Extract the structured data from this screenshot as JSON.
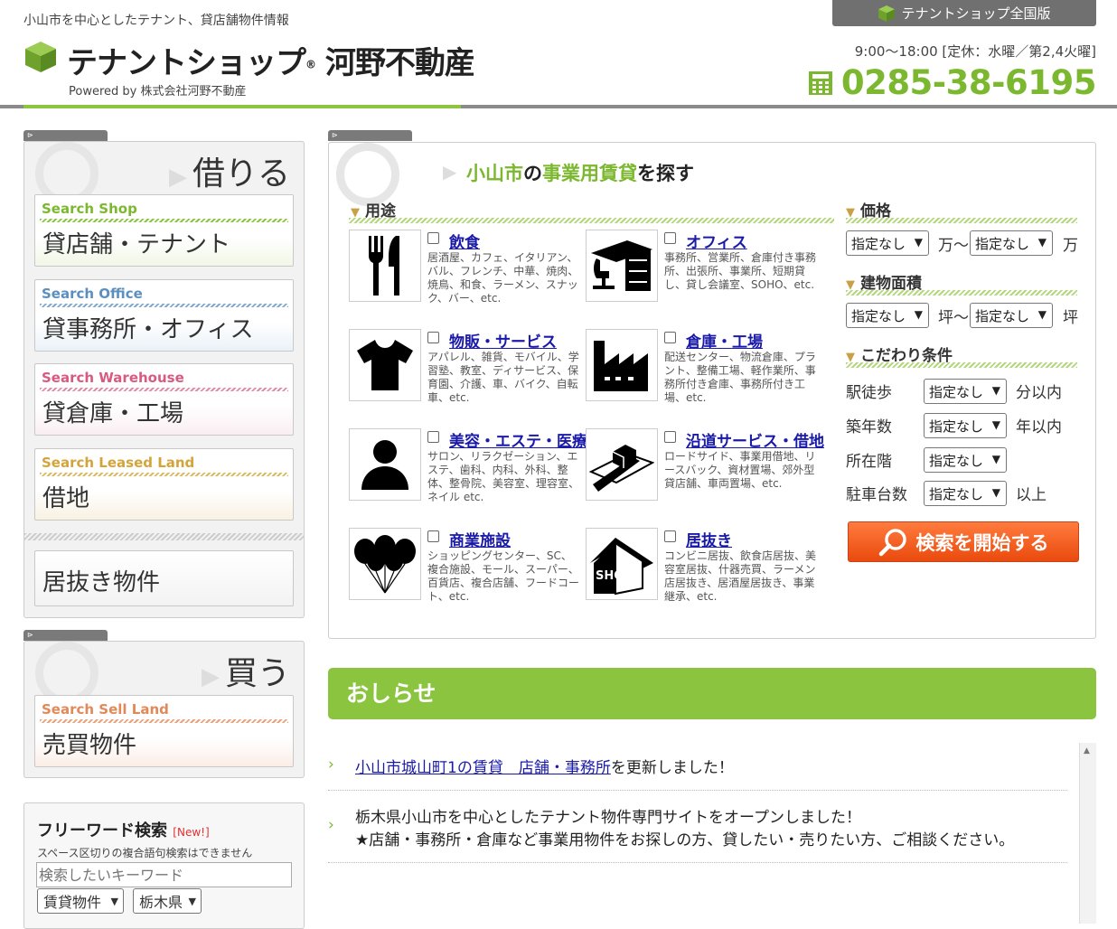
{
  "header": {
    "tagline": "小山市を中心としたテナント、貸店舗物件情報",
    "logo_text": "テナントショップ",
    "logo_company": "河野不動産",
    "logo_sub": "Powered by 株式会社河野不動産",
    "national_label": "テナントショップ全国版",
    "hours": "9:00～18:00 [定休：水曜／第2,4火曜]",
    "phone": "0285-38-6195"
  },
  "sidebar": {
    "rent_heading": "借りる",
    "rent_items": [
      {
        "en": "Search Shop",
        "jp": "貸店舗・テナント"
      },
      {
        "en": "Search Office",
        "jp": "貸事務所・オフィス"
      },
      {
        "en": "Search Warehouse",
        "jp": "貸倉庫・工場"
      },
      {
        "en": "Search Leased Land",
        "jp": "借地"
      }
    ],
    "inuki": "居抜き物件",
    "buy_heading": "買う",
    "buy_items": [
      {
        "en": "Search Sell Land",
        "jp": "売買物件"
      }
    ],
    "freeword": {
      "title": "フリーワード検索",
      "new_badge": "[New!]",
      "note": "スペース区切りの複合語句検索はできません",
      "placeholder": "検索したいキーワード",
      "type_select": "賃貸物件",
      "pref_select": "栃木県"
    }
  },
  "main": {
    "title_city": "小山市",
    "title_no": "の",
    "title_type": "事業用賃貸",
    "title_end": "を探す",
    "usage_heading": "用途",
    "categories": [
      {
        "title": "飲食",
        "desc": "居酒屋、カフェ、イタリアン、バル、フレンチ、中華、焼肉、焼鳥、和食、ラーメン、スナック、バー、etc.",
        "icon": "fork-knife-icon"
      },
      {
        "title": "オフィス",
        "desc": "事務所、営業所、倉庫付き事務所、出張所、事業所、短期貸し、貸し会議室、SOHO、etc.",
        "icon": "desk-icon"
      },
      {
        "title": "物販・サービス",
        "desc": "アパレル、雑貨、モバイル、学習塾、教室、ディサービス、保育園、介護、車、バイク、自転車、etc.",
        "icon": "tshirt-icon"
      },
      {
        "title": "倉庫・工場",
        "desc": "配送センター、物流倉庫、プラント、整備工場、軽作業所、事務所付き倉庫、事務所付き工場、etc.",
        "icon": "factory-icon"
      },
      {
        "title": "美容・エステ・医療",
        "desc": "サロン、リラクゼーション、エステ、歯科、内科、外科、整体、整骨院、美容室、理容室、ネイル etc.",
        "icon": "person-icon"
      },
      {
        "title": "沿道サービス・借地",
        "desc": "ロードサイド、事業用借地、リースバック、資材置場、郊外型貸店舗、車両置場、etc.",
        "icon": "roadside-land-icon"
      },
      {
        "title": "商業施設",
        "desc": "ショッピングセンター、SC、複合施設、モール、スーパー、百貨店、複合店舗、フードコート、etc.",
        "icon": "balloons-icon"
      },
      {
        "title": "居抜き",
        "desc": "コンビニ居抜、飲食店居抜、美容室居抜、什器売買、ラーメン店居抜き、居酒屋居抜き、事業継承、etc.",
        "icon": "shop-house-icon"
      }
    ],
    "price_heading": "価格",
    "price_from": "指定なし",
    "price_unit1": "万～",
    "price_to": "指定なし",
    "price_unit2": "万",
    "area_heading": "建物面積",
    "area_from": "指定なし",
    "area_unit1": "坪～",
    "area_to": "指定なし",
    "area_unit2": "坪",
    "cond_heading": "こだわり条件",
    "conditions": [
      {
        "label": "駅徒歩",
        "value": "指定なし",
        "suffix": "分以内"
      },
      {
        "label": "築年数",
        "value": "指定なし",
        "suffix": "年以内"
      },
      {
        "label": "所在階",
        "value": "指定なし",
        "suffix": ""
      },
      {
        "label": "駐車台数",
        "value": "指定なし",
        "suffix": "以上"
      }
    ],
    "search_button": "検索を開始する"
  },
  "news": {
    "heading": "おしらせ",
    "items": [
      {
        "link": "小山市城山町1の賃貸　店舗・事務所",
        "text": "を更新しました！"
      },
      {
        "line1": "栃木県小山市を中心としたテナント物件専門サイトをオープンしました！",
        "line2": "★店舗・事務所・倉庫など事業用物件をお探しの方、貸したい・売りたい方、ご相談ください。"
      }
    ]
  },
  "colors": {
    "brand_green": "#8bc53f",
    "search_orange": "#ef5a16",
    "link_blue": "#1a1aa8"
  }
}
